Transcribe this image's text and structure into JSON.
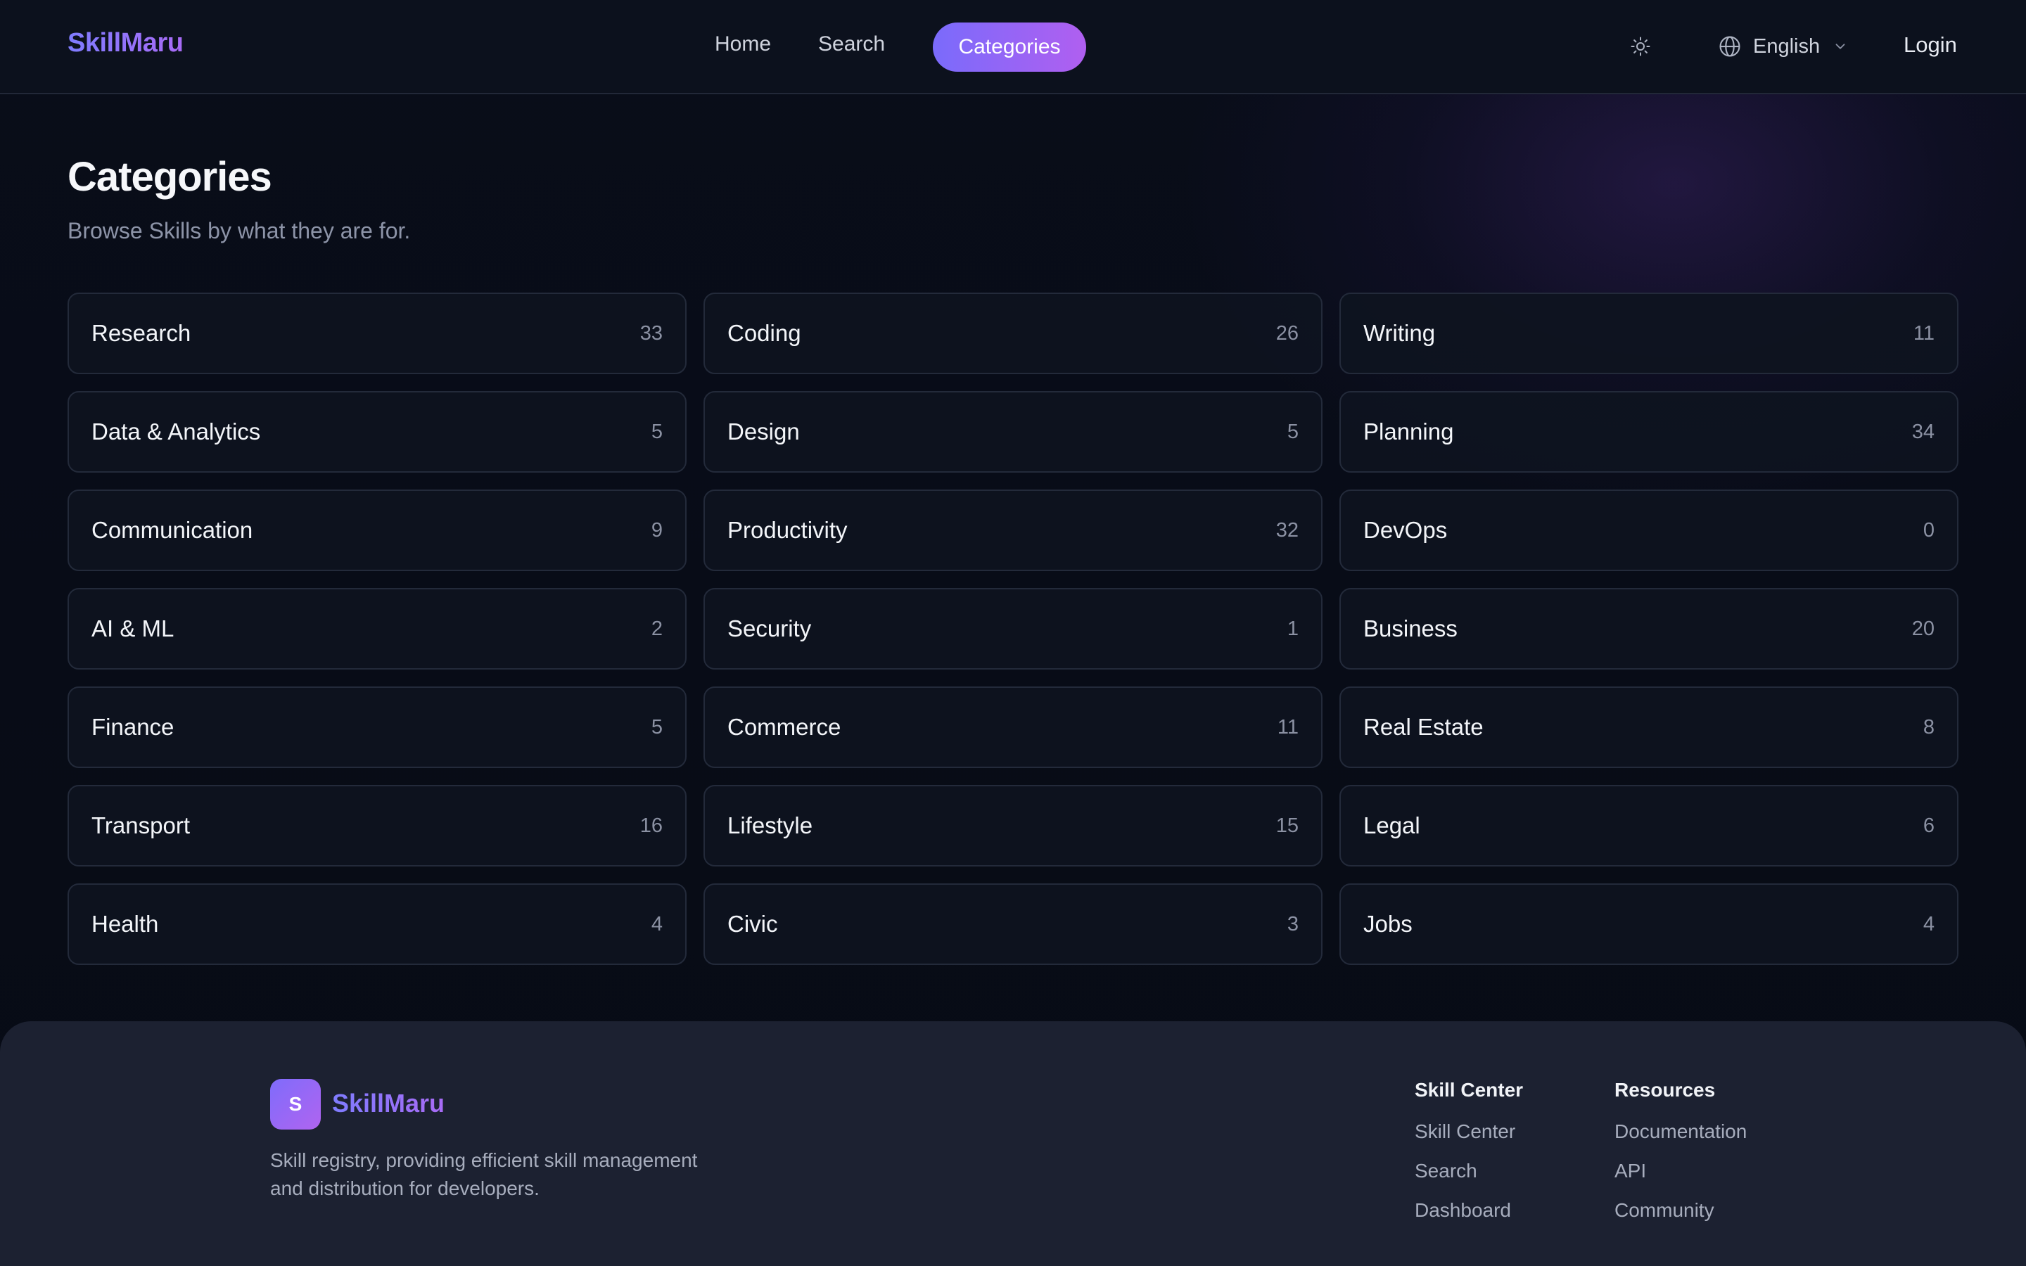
{
  "header": {
    "brand": "SkillMaru",
    "nav": {
      "home": "Home",
      "search": "Search",
      "categories": "Categories"
    },
    "theme_icon": "sun-icon",
    "language": "English",
    "login": "Login"
  },
  "main": {
    "title": "Categories",
    "subtitle": "Browse Skills by what they are for.",
    "categories": [
      {
        "name": "Research",
        "count": "33"
      },
      {
        "name": "Coding",
        "count": "26"
      },
      {
        "name": "Writing",
        "count": "11"
      },
      {
        "name": "Data & Analytics",
        "count": "5"
      },
      {
        "name": "Design",
        "count": "5"
      },
      {
        "name": "Planning",
        "count": "34"
      },
      {
        "name": "Communication",
        "count": "9"
      },
      {
        "name": "Productivity",
        "count": "32"
      },
      {
        "name": "DevOps",
        "count": "0"
      },
      {
        "name": "AI & ML",
        "count": "2"
      },
      {
        "name": "Security",
        "count": "1"
      },
      {
        "name": "Business",
        "count": "20"
      },
      {
        "name": "Finance",
        "count": "5"
      },
      {
        "name": "Commerce",
        "count": "11"
      },
      {
        "name": "Real Estate",
        "count": "8"
      },
      {
        "name": "Transport",
        "count": "16"
      },
      {
        "name": "Lifestyle",
        "count": "15"
      },
      {
        "name": "Legal",
        "count": "6"
      },
      {
        "name": "Health",
        "count": "4"
      },
      {
        "name": "Civic",
        "count": "3"
      },
      {
        "name": "Jobs",
        "count": "4"
      }
    ]
  },
  "footer": {
    "logo_letter": "S",
    "brand": "SkillMaru",
    "description": "Skill registry, providing efficient skill management and distribution for developers.",
    "columns": [
      {
        "heading": "Skill Center",
        "links": [
          "Skill Center",
          "Search",
          "Dashboard"
        ]
      },
      {
        "heading": "Resources",
        "links": [
          "Documentation",
          "API",
          "Community"
        ]
      }
    ]
  },
  "colors": {
    "accent_start": "#7a6bfb",
    "accent_end": "#b05ff0",
    "background": "#080c17",
    "card_bg": "#0e131f",
    "footer_bg": "#1c2131"
  }
}
